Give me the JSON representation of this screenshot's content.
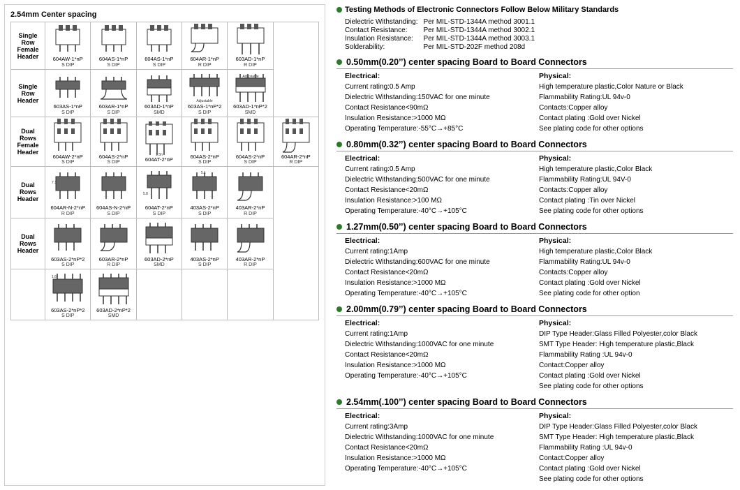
{
  "left": {
    "title": "2.54mm Center spacing",
    "rows": [
      {
        "rowHeader": "Single Row\nFemale Header",
        "cells": [
          {
            "label": "604AW-1*nP",
            "type": "S DIP",
            "svgType": "female-single-sdip"
          },
          {
            "label": "604AS-1*nP",
            "type": "S DIP",
            "svgType": "female-single-sdip2"
          },
          {
            "label": "604AS-1*nP",
            "type": "S DIP",
            "svgType": "female-single-sdip3"
          },
          {
            "label": "604AR-1*nP",
            "type": "R DIP",
            "svgType": "female-single-rdip"
          },
          {
            "label": "603AD-1*nP",
            "type": "R DIP",
            "svgType": "female-single-rdip2"
          }
        ]
      },
      {
        "rowHeader": "Single Row\nHeader",
        "cells": [
          {
            "label": "603AS-1*nP",
            "type": "S DIP",
            "svgType": "single-sdip"
          },
          {
            "label": "603AR-1*nP",
            "type": "S DIP",
            "svgType": "single-sdip2"
          },
          {
            "label": "603AD-1*nP",
            "type": "SMD",
            "svgType": "single-smd"
          },
          {
            "label": "603AS-1*nP*2",
            "type": "S DIP",
            "svgType": "single-sdip3"
          },
          {
            "label": "603AD-1*nP*2",
            "type": "SMD",
            "svgType": "single-smd2"
          }
        ]
      },
      {
        "rowHeader": "Dual Rows\nFemale Header",
        "cells": [
          {
            "label": "604AW-2*nP",
            "type": "S DIP",
            "svgType": "dual-female-sdip"
          },
          {
            "label": "604AS-2*nP",
            "type": "S DIP",
            "svgType": "dual-female-sdip2"
          },
          {
            "label": "604AT-2*nP",
            "type": "",
            "svgType": "dual-female-t"
          },
          {
            "label": "604AS-2*nP",
            "type": "S DIP",
            "svgType": "dual-female-sdip3"
          },
          {
            "label": "604AS-2*nP",
            "type": "S DIP",
            "svgType": "dual-female-sdip4"
          },
          {
            "label": "604AR-2*nP",
            "type": "R DIP",
            "svgType": "dual-female-rdip"
          }
        ]
      },
      {
        "rowHeader": "Dual Rows\nHeader",
        "cells": [
          {
            "label": "604AR-N-2*nP",
            "type": "R DIP",
            "svgType": "dual-rdip"
          },
          {
            "label": "604AS-N-2*nP",
            "type": "S DIP",
            "svgType": "dual-sdip"
          },
          {
            "label": "604AT-2*nP",
            "type": "S DIP",
            "svgType": "dual-t"
          },
          {
            "label": "403AS-2*nP",
            "type": "S DIP",
            "svgType": "dual-sdip2"
          },
          {
            "label": "403AR-2*nP",
            "type": "R DIP",
            "svgType": "dual-rdip2"
          }
        ]
      },
      {
        "rowHeader": "Dual Rows\nHeader",
        "cells": [
          {
            "label": "603AS-2*nP*2",
            "type": "S DIP",
            "svgType": "dual2-sdip"
          },
          {
            "label": "603AR-2*nP",
            "type": "R DIP",
            "svgType": "dual2-rdip"
          },
          {
            "label": "603AD-2*nP",
            "type": "SMD",
            "svgType": "dual2-smd"
          },
          {
            "label": "403AS-2*nP",
            "type": "S DIP",
            "svgType": "dual2-sdip2"
          },
          {
            "label": "403AR-2*nP",
            "type": "R DIP",
            "svgType": "dual2-rdip2"
          }
        ]
      },
      {
        "rowHeader": "",
        "cells": [
          {
            "label": "603AS-2*nP*2",
            "type": "S DIP",
            "svgType": "last-sdip"
          },
          {
            "label": "603AD-2*nP*2",
            "type": "SMD",
            "svgType": "last-smd"
          }
        ]
      }
    ]
  },
  "right": {
    "testingTitle": "Testing Methods of Electronic Connectors Follow Below Military Standards",
    "testingMethods": [
      {
        "label": "Dielectric Withstanding:",
        "value": "Per MIL-STD-1344A method 3001.1"
      },
      {
        "label": "Contact  Resistance:",
        "value": "Per MIL-STD-1344A method 3002.1"
      },
      {
        "label": "Insulation Resistance:",
        "value": "Per MIL-STD-1344A method 3003.1"
      },
      {
        "label": "Solderability:",
        "value": "Per MIL-STD-202F method 208d"
      }
    ],
    "sections": [
      {
        "title": "0.50mm(0.20’’) center spacing Board to Board Connectors",
        "electrical": {
          "title": "Electrical:",
          "lines": [
            "Current rating:0.5 Amp",
            "Dielectric Withstanding:150VAC for one minute",
            "Contact Resistance<90mΩ",
            "Insulation Resistance:>1000 MΩ",
            "Operating  Temperature:-55°C→+85°C"
          ]
        },
        "physical": {
          "title": "Physical:",
          "lines": [
            "High temperature plastic,Color Nature or Black",
            "Flammability Rating:UL 94v-0",
            "Contacts:Copper alloy",
            "Contact plating :Gold over Nickel",
            "See plating code for other options"
          ]
        }
      },
      {
        "title": "0.80mm(0.32’’) center spacing Board to Board Connectors",
        "electrical": {
          "title": "Electrical:",
          "lines": [
            "Current rating:0.5 Amp",
            "Dielectric Withstanding:500VAC for one minute",
            "Contact Resistance<20mΩ",
            "Insulation Resistance:>100 MΩ",
            "Operating  Temperature:-40°C→+105°C"
          ]
        },
        "physical": {
          "title": "Physical:",
          "lines": [
            "High temperature plastic,Color Black",
            "Flammability Rating:UL 94V-0",
            "Contacts:Copper alloy",
            "Contact plating :Tin over Nickel",
            "See plating code for other options"
          ]
        }
      },
      {
        "title": "1.27mm(0.50’’) center spacing Board to Board Connectors",
        "electrical": {
          "title": "Electrical:",
          "lines": [
            "Current rating:1Amp",
            "Dielectric Withstanding:600VAC for one minute",
            "Contact Resistance<20mΩ",
            "Insulation Resistance:>1000 MΩ",
            "Operating  Temperature:-40°C→+105°C"
          ]
        },
        "physical": {
          "title": "Physical:",
          "lines": [
            "High temperature plastic,Color Black",
            "Flammability Rating:UL 94v-0",
            "Contacts:Copper alloy",
            "Contact plating :Gold  over Nickel",
            "See plating code for other option"
          ]
        }
      },
      {
        "title": "2.00mm(0.79’’) center spacing Board to Board Connectors",
        "electrical": {
          "title": "Electrical:",
          "lines": [
            "Current rating:1Amp",
            "Dielectric Withstanding:1000VAC for one minute",
            "Contact Resistance<20mΩ",
            "Insulation Resistance:>1000 MΩ",
            "Operating  Temperature:-40°C→+105°C"
          ]
        },
        "physical": {
          "title": "Physical:",
          "lines": [
            "DIP Type Header:Glass Filled Polyester,color Black",
            "SMT Type Header: High temperature plastic,Black",
            "Flammability Rating :UL 94v-0",
            "Contact:Copper alloy",
            "Contact plating :Gold over Nickel",
            "See plating code for other options"
          ]
        }
      },
      {
        "title": "2.54mm(.100’’) center spacing Board to Board Connectors",
        "electrical": {
          "title": "Electrical:",
          "lines": [
            "Current rating:3Amp",
            "Dielectric Withstanding:1000VAC for one minute",
            "Contact Resistance<20mΩ",
            "Insulation Resistance:>1000 MΩ",
            "Operating  Temperature:-40°C→+105°C"
          ]
        },
        "physical": {
          "title": "Physical:",
          "lines": [
            "DIP Type Header:Glass Filled Polyester,color Black",
            "SMT Type Header: High temperature plastic,Black",
            "Flammability Rating :UL 94v-0",
            "Contact:Copper alloy",
            "Contact plating :Gold over Nickel",
            "See plating code for other options"
          ]
        }
      }
    ]
  }
}
